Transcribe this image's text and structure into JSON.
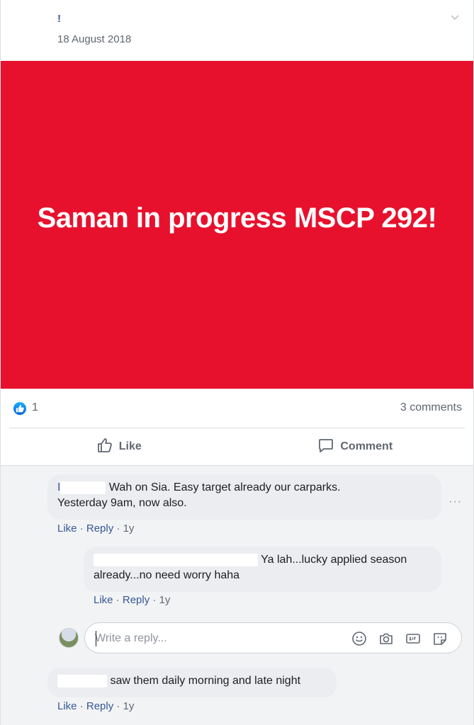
{
  "post": {
    "author_initial": "!",
    "date": "18 August 2018",
    "banner_text": "Saman in progress MSCP 292!",
    "banner_color": "#e8112d"
  },
  "reactions": {
    "like_count": "1",
    "comments_count": "3 comments"
  },
  "actions": {
    "like_label": "Like",
    "comment_label": "Comment"
  },
  "comments": [
    {
      "name_prefix": "I",
      "text_line1": "Wah on Sia. Easy target already our carparks.",
      "text_line2": "Yesterday 9am, now also.",
      "like": "Like",
      "reply": "Reply",
      "age": "1y",
      "more": "···"
    },
    {
      "text_line1": "Ya lah...lucky applied season",
      "text_line2": "already...no need worry haha",
      "like": "Like",
      "reply": "Reply",
      "age": "1y"
    },
    {
      "text_line1": "saw them daily morning and late night",
      "like": "Like",
      "reply": "Reply",
      "age": "1y"
    }
  ],
  "reply_box": {
    "placeholder": "Write a reply..."
  },
  "icons": [
    "chevron-down-icon",
    "like-badge-icon",
    "thumbs-up-icon",
    "comment-icon",
    "emoji-icon",
    "camera-icon",
    "gif-icon",
    "sticker-icon"
  ]
}
